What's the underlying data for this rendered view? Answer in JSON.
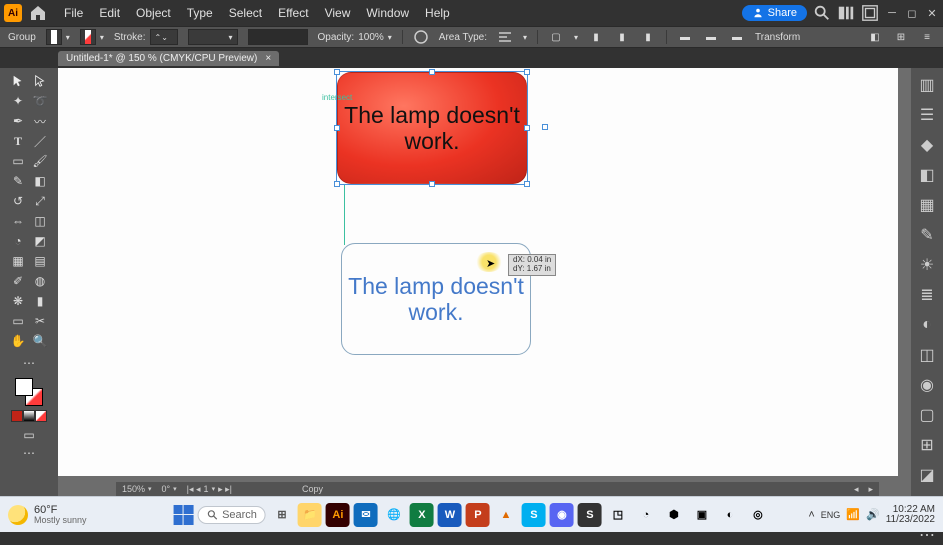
{
  "menubar": {
    "app_badge": "Ai",
    "items": [
      "File",
      "Edit",
      "Object",
      "Type",
      "Select",
      "Effect",
      "View",
      "Window",
      "Help"
    ],
    "share_label": "Share"
  },
  "controlbar": {
    "mode_label": "Group",
    "stroke_label": "Stroke:",
    "opacity_label": "Opacity:",
    "opacity_value": "100%",
    "area_type_label": "Area Type:",
    "transform_label": "Transform"
  },
  "doc_tab": {
    "title": "Untitled-1* @ 150 % (CMYK/CPU Preview)"
  },
  "canvas": {
    "red_text": "The lamp doesn't work.",
    "drag_text": "The lamp doesn't work.",
    "intersect_label": "intersect",
    "measure_line1": "dX: 0.04 in",
    "measure_line2": "dY: 1.67 in"
  },
  "status": {
    "zoom": "150%",
    "rotate": "0°",
    "artboard_nav": "1",
    "action": "Copy"
  },
  "taskbar": {
    "temp": "60°F",
    "weather": "Mostly sunny",
    "search_placeholder": "Search",
    "time": "10:22 AM",
    "date": "11/23/2022"
  }
}
